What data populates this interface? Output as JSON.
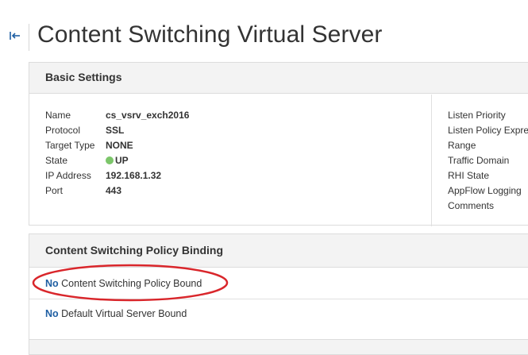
{
  "header": {
    "title": "Content Switching Virtual Server"
  },
  "basic_settings": {
    "heading": "Basic Settings",
    "fields": [
      {
        "label": "Name",
        "value": "cs_vsrv_exch2016"
      },
      {
        "label": "Protocol",
        "value": "SSL"
      },
      {
        "label": "Target Type",
        "value": "NONE"
      },
      {
        "label": "State",
        "value": "UP",
        "status_color": "#7cc66a"
      },
      {
        "label": "IP Address",
        "value": "192.168.1.32"
      },
      {
        "label": "Port",
        "value": "443"
      }
    ],
    "right_labels": [
      "Listen Priority",
      "Listen Policy Express",
      "Range",
      "Traffic Domain",
      "RHI State",
      "AppFlow Logging",
      "Comments"
    ]
  },
  "policy_binding": {
    "heading": "Content Switching Policy Binding",
    "rows": [
      {
        "prefix": "No",
        "text": " Content Switching Policy Bound"
      },
      {
        "prefix": "No",
        "text": " Default Virtual Server Bound"
      }
    ]
  },
  "colors": {
    "link_blue": "#1f5fa3",
    "annotation_red": "#d9262b",
    "header_bg": "#f3f3f3"
  },
  "icons": {
    "back": "back-arrow-icon"
  }
}
